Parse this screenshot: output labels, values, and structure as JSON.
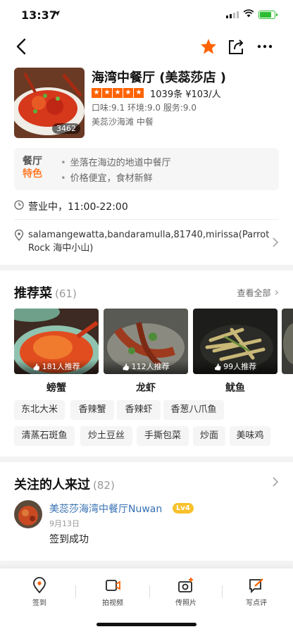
{
  "status_bar": {
    "time": "13:37",
    "location_arrow": "location-arrow-icon",
    "battery_level": 0.85
  },
  "nav": {
    "back_icon": "chevron-left-icon",
    "favorite_icon": "star-icon",
    "share_icon": "share-icon",
    "more_icon": "more-icon"
  },
  "restaurant": {
    "name": "海湾中餐厅 (美蕊莎店 )",
    "photo_count": "3462",
    "rating_stars": 5,
    "reviews": "1039条  ¥103/人",
    "scores": "口味:9.1 环境:9.0 服务:9.0",
    "area_category": "美蕊沙海滩   中餐"
  },
  "features": {
    "label_top": "餐厅",
    "label_bottom": "特色",
    "items": [
      "坐落在海边的地道中餐厅",
      "价格便宜，食材新鲜"
    ]
  },
  "hours": {
    "text": "营业中，11:00-22:00"
  },
  "address": {
    "text": "salamangewatta,bandaramulla,81740,mirissa(Parrot Rock 海中小山)"
  },
  "dishes": {
    "title": "推荐菜",
    "count": "(61)",
    "see_all": "查看全部",
    "items": [
      {
        "name": "螃蟹",
        "recommend": "181人推荐"
      },
      {
        "name": "龙虾",
        "recommend": "112人推荐"
      },
      {
        "name": "鱿鱼",
        "recommend": "99人推荐"
      }
    ],
    "tags": [
      "东北大米",
      "香辣蟹",
      "香辣虾",
      "香葱八爪鱼",
      "清蒸石斑鱼",
      "炒土豆丝",
      "手撕包菜",
      "炒面",
      "美味鸡"
    ]
  },
  "followers": {
    "title": "关注的人来过",
    "count": "(82)",
    "user": {
      "name": "美蕊莎海湾中餐厅Nuwan",
      "level": "Lv4",
      "date": "9月13日",
      "content": "签到成功"
    }
  },
  "tabbar": [
    {
      "label": "签到",
      "icon": "location-pin-icon"
    },
    {
      "label": "拍视频",
      "icon": "video-camera-icon"
    },
    {
      "label": "传照片",
      "icon": "camera-plus-icon"
    },
    {
      "label": "写点评",
      "icon": "edit-review-icon"
    }
  ],
  "colors": {
    "accent": "#ff6200",
    "feature_highlight": "#ff7a2a",
    "link": "#3570b2",
    "level_badge": "#f8c12c"
  }
}
